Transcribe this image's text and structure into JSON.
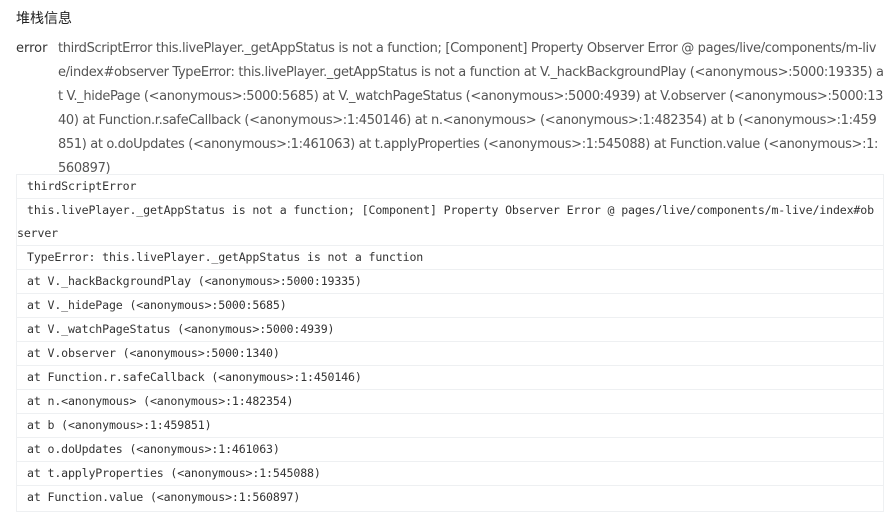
{
  "section": {
    "title": "堆栈信息"
  },
  "error": {
    "label": "error",
    "message": "thirdScriptError this.livePlayer._getAppStatus is not a function; [Component] Property Observer Error @ pages/live/components/m-live/index#observer TypeError: this.livePlayer._getAppStatus is not a function at V._hackBackgroundPlay (<anonymous>:5000:19335) at V._hidePage (<anonymous>:5000:5685) at V._watchPageStatus (<anonymous>:5000:4939) at V.observer (<anonymous>:5000:1340) at Function.r.safeCallback (<anonymous>:1:450146) at n.<anonymous> (<anonymous>:1:482354) at b (<anonymous>:1:459851) at o.doUpdates (<anonymous>:1:461063) at t.applyProperties (<anonymous>:1:545088) at Function.value (<anonymous>:1:560897)"
  },
  "stack": {
    "lines": [
      "thirdScriptError",
      "this.livePlayer._getAppStatus is not a function; [Component] Property Observer Error @ pages/live/components/m-live/index#observer",
      "TypeError: this.livePlayer._getAppStatus is not a function",
      "at V._hackBackgroundPlay (<anonymous>:5000:19335)",
      "at V._hidePage (<anonymous>:5000:5685)",
      "at V._watchPageStatus (<anonymous>:5000:4939)",
      "at V.observer (<anonymous>:5000:1340)",
      "at Function.r.safeCallback (<anonymous>:1:450146)",
      "at n.<anonymous> (<anonymous>:1:482354)",
      "at b (<anonymous>:1:459851)",
      "at o.doUpdates (<anonymous>:1:461063)",
      "at t.applyProperties (<anonymous>:1:545088)",
      "at Function.value (<anonymous>:1:560897)"
    ]
  }
}
